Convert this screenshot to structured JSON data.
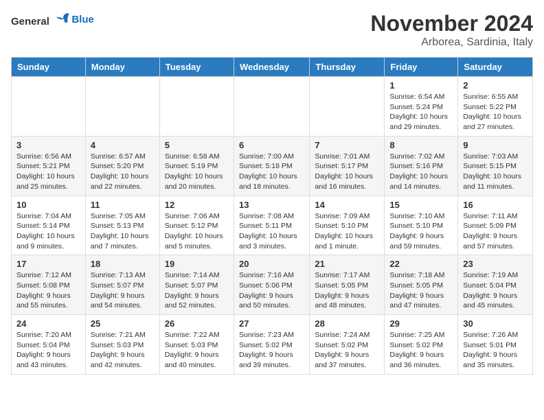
{
  "header": {
    "logo": {
      "general": "General",
      "blue": "Blue"
    },
    "title": "November 2024",
    "subtitle": "Arborea, Sardinia, Italy"
  },
  "columns": [
    "Sunday",
    "Monday",
    "Tuesday",
    "Wednesday",
    "Thursday",
    "Friday",
    "Saturday"
  ],
  "weeks": [
    [
      {
        "day": "",
        "info": ""
      },
      {
        "day": "",
        "info": ""
      },
      {
        "day": "",
        "info": ""
      },
      {
        "day": "",
        "info": ""
      },
      {
        "day": "",
        "info": ""
      },
      {
        "day": "1",
        "info": "Sunrise: 6:54 AM\nSunset: 5:24 PM\nDaylight: 10 hours and 29 minutes."
      },
      {
        "day": "2",
        "info": "Sunrise: 6:55 AM\nSunset: 5:22 PM\nDaylight: 10 hours and 27 minutes."
      }
    ],
    [
      {
        "day": "3",
        "info": "Sunrise: 6:56 AM\nSunset: 5:21 PM\nDaylight: 10 hours and 25 minutes."
      },
      {
        "day": "4",
        "info": "Sunrise: 6:57 AM\nSunset: 5:20 PM\nDaylight: 10 hours and 22 minutes."
      },
      {
        "day": "5",
        "info": "Sunrise: 6:58 AM\nSunset: 5:19 PM\nDaylight: 10 hours and 20 minutes."
      },
      {
        "day": "6",
        "info": "Sunrise: 7:00 AM\nSunset: 5:18 PM\nDaylight: 10 hours and 18 minutes."
      },
      {
        "day": "7",
        "info": "Sunrise: 7:01 AM\nSunset: 5:17 PM\nDaylight: 10 hours and 16 minutes."
      },
      {
        "day": "8",
        "info": "Sunrise: 7:02 AM\nSunset: 5:16 PM\nDaylight: 10 hours and 14 minutes."
      },
      {
        "day": "9",
        "info": "Sunrise: 7:03 AM\nSunset: 5:15 PM\nDaylight: 10 hours and 11 minutes."
      }
    ],
    [
      {
        "day": "10",
        "info": "Sunrise: 7:04 AM\nSunset: 5:14 PM\nDaylight: 10 hours and 9 minutes."
      },
      {
        "day": "11",
        "info": "Sunrise: 7:05 AM\nSunset: 5:13 PM\nDaylight: 10 hours and 7 minutes."
      },
      {
        "day": "12",
        "info": "Sunrise: 7:06 AM\nSunset: 5:12 PM\nDaylight: 10 hours and 5 minutes."
      },
      {
        "day": "13",
        "info": "Sunrise: 7:08 AM\nSunset: 5:11 PM\nDaylight: 10 hours and 3 minutes."
      },
      {
        "day": "14",
        "info": "Sunrise: 7:09 AM\nSunset: 5:10 PM\nDaylight: 10 hours and 1 minute."
      },
      {
        "day": "15",
        "info": "Sunrise: 7:10 AM\nSunset: 5:10 PM\nDaylight: 9 hours and 59 minutes."
      },
      {
        "day": "16",
        "info": "Sunrise: 7:11 AM\nSunset: 5:09 PM\nDaylight: 9 hours and 57 minutes."
      }
    ],
    [
      {
        "day": "17",
        "info": "Sunrise: 7:12 AM\nSunset: 5:08 PM\nDaylight: 9 hours and 55 minutes."
      },
      {
        "day": "18",
        "info": "Sunrise: 7:13 AM\nSunset: 5:07 PM\nDaylight: 9 hours and 54 minutes."
      },
      {
        "day": "19",
        "info": "Sunrise: 7:14 AM\nSunset: 5:07 PM\nDaylight: 9 hours and 52 minutes."
      },
      {
        "day": "20",
        "info": "Sunrise: 7:16 AM\nSunset: 5:06 PM\nDaylight: 9 hours and 50 minutes."
      },
      {
        "day": "21",
        "info": "Sunrise: 7:17 AM\nSunset: 5:05 PM\nDaylight: 9 hours and 48 minutes."
      },
      {
        "day": "22",
        "info": "Sunrise: 7:18 AM\nSunset: 5:05 PM\nDaylight: 9 hours and 47 minutes."
      },
      {
        "day": "23",
        "info": "Sunrise: 7:19 AM\nSunset: 5:04 PM\nDaylight: 9 hours and 45 minutes."
      }
    ],
    [
      {
        "day": "24",
        "info": "Sunrise: 7:20 AM\nSunset: 5:04 PM\nDaylight: 9 hours and 43 minutes."
      },
      {
        "day": "25",
        "info": "Sunrise: 7:21 AM\nSunset: 5:03 PM\nDaylight: 9 hours and 42 minutes."
      },
      {
        "day": "26",
        "info": "Sunrise: 7:22 AM\nSunset: 5:03 PM\nDaylight: 9 hours and 40 minutes."
      },
      {
        "day": "27",
        "info": "Sunrise: 7:23 AM\nSunset: 5:02 PM\nDaylight: 9 hours and 39 minutes."
      },
      {
        "day": "28",
        "info": "Sunrise: 7:24 AM\nSunset: 5:02 PM\nDaylight: 9 hours and 37 minutes."
      },
      {
        "day": "29",
        "info": "Sunrise: 7:25 AM\nSunset: 5:02 PM\nDaylight: 9 hours and 36 minutes."
      },
      {
        "day": "30",
        "info": "Sunrise: 7:26 AM\nSunset: 5:01 PM\nDaylight: 9 hours and 35 minutes."
      }
    ]
  ]
}
